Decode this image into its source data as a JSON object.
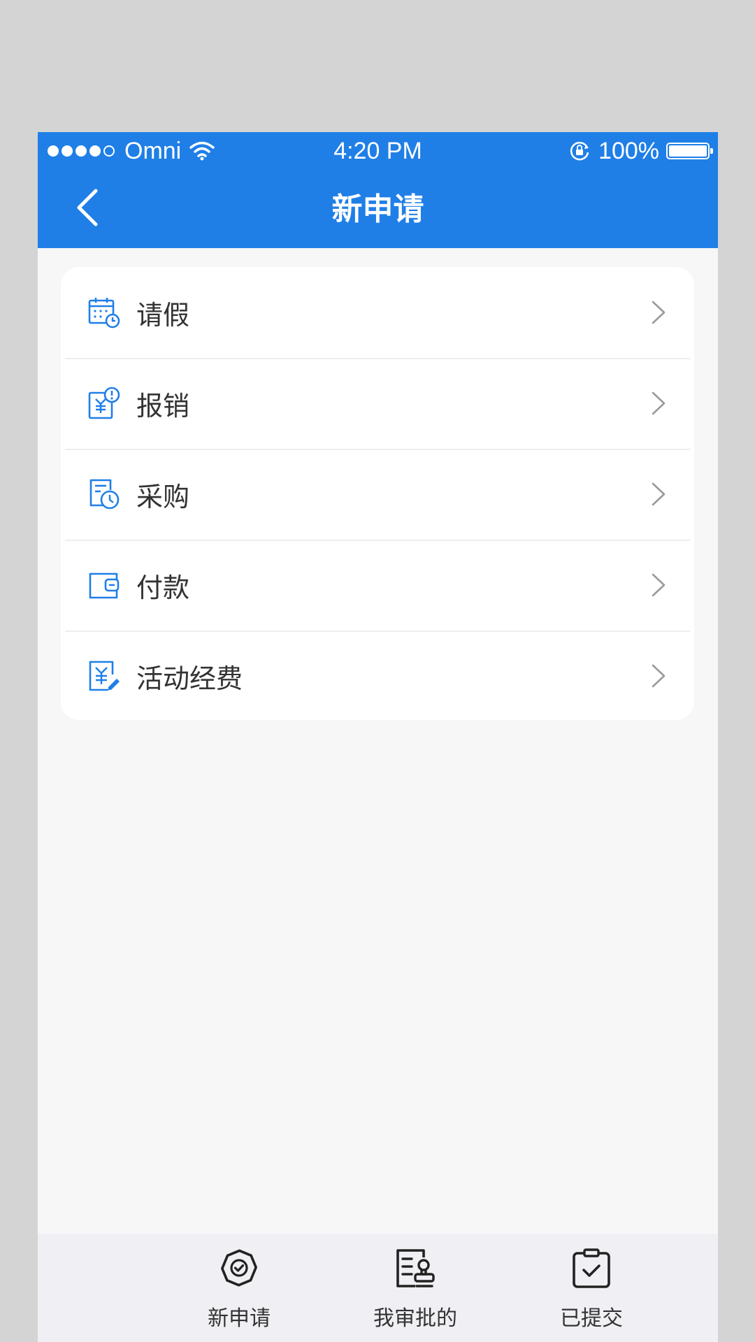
{
  "status_bar": {
    "carrier": "Omni",
    "time": "4:20 PM",
    "battery": "100%"
  },
  "nav": {
    "title": "新申请"
  },
  "menu": {
    "items": [
      {
        "label": "请假",
        "icon": "calendar-clock-icon"
      },
      {
        "label": "报销",
        "icon": "yen-receipt-icon"
      },
      {
        "label": "采购",
        "icon": "document-clock-icon"
      },
      {
        "label": "付款",
        "icon": "wallet-icon"
      },
      {
        "label": "活动经费",
        "icon": "yen-edit-icon"
      }
    ]
  },
  "tabbar": {
    "items": [
      {
        "label": "新申请",
        "icon": "new-application-icon"
      },
      {
        "label": "我审批的",
        "icon": "approval-icon"
      },
      {
        "label": "已提交",
        "icon": "submitted-icon"
      }
    ]
  },
  "colors": {
    "primary": "#1f7fe7",
    "background": "#f7f7f8",
    "tabbar": "#f0f0f4",
    "text": "#333333"
  }
}
